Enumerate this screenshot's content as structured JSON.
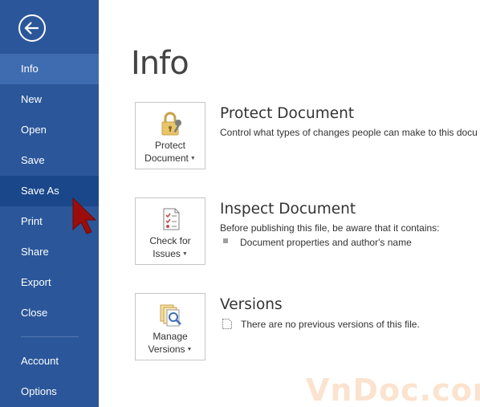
{
  "sidebar": {
    "back_icon": "back-arrow-icon",
    "items": [
      {
        "label": "Info"
      },
      {
        "label": "New"
      },
      {
        "label": "Open"
      },
      {
        "label": "Save"
      },
      {
        "label": "Save As"
      },
      {
        "label": "Print"
      },
      {
        "label": "Share"
      },
      {
        "label": "Export"
      },
      {
        "label": "Close"
      },
      {
        "label": "Account"
      },
      {
        "label": "Options"
      }
    ],
    "active": "Info",
    "hovered": "Save As"
  },
  "main": {
    "title": "Info",
    "sections": [
      {
        "button_line1": "Protect",
        "button_line2": "Document",
        "icon": "lock-key-icon",
        "title": "Protect Document",
        "description": "Control what types of changes people can make to this docu"
      },
      {
        "button_line1": "Check for",
        "button_line2": "Issues",
        "icon": "checklist-icon",
        "title": "Inspect Document",
        "description": "Before publishing this file, be aware that it contains:",
        "bullet": "Document properties and author's name"
      },
      {
        "button_line1": "Manage",
        "button_line2": "Versions",
        "icon": "document-search-icon",
        "title": "Versions",
        "note": "There are no previous versions of this file."
      }
    ]
  },
  "watermark": "VnDoc.com",
  "colors": {
    "sidebar": "#2b579a",
    "sidebar_active": "#3f6cb0",
    "sidebar_hover": "#19478a",
    "cursor": "#9b0d0d"
  }
}
